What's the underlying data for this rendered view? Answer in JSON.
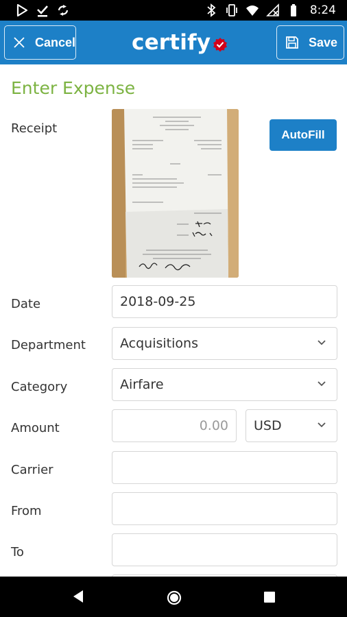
{
  "status_bar": {
    "time": "8:24",
    "left_icons": [
      "play-store-icon",
      "download-done-icon",
      "sync-icon"
    ],
    "right_icons": [
      "bluetooth-icon",
      "vibrate-icon",
      "wifi-icon",
      "no-signal-icon",
      "battery-icon"
    ]
  },
  "app_bar": {
    "cancel_label": "Cancel",
    "logo_text": "certify",
    "save_label": "Save",
    "brand_color": "#1d80c7",
    "badge_color": "#d0021b"
  },
  "form": {
    "title": "Enter Expense",
    "title_color": "#7cb342",
    "receipt_label": "Receipt",
    "autofill_label": "AutoFill",
    "date_label": "Date",
    "date_value": "2018-09-25",
    "department_label": "Department",
    "department_value": "Acquisitions",
    "category_label": "Category",
    "category_value": "Airfare",
    "amount_label": "Amount",
    "amount_placeholder": "0.00",
    "currency_value": "USD",
    "carrier_label": "Carrier",
    "carrier_value": "",
    "from_label": "From",
    "from_value": "",
    "to_label": "To",
    "to_value": ""
  },
  "nav_bar": {
    "buttons": [
      "back-icon",
      "home-icon",
      "recents-icon"
    ]
  }
}
